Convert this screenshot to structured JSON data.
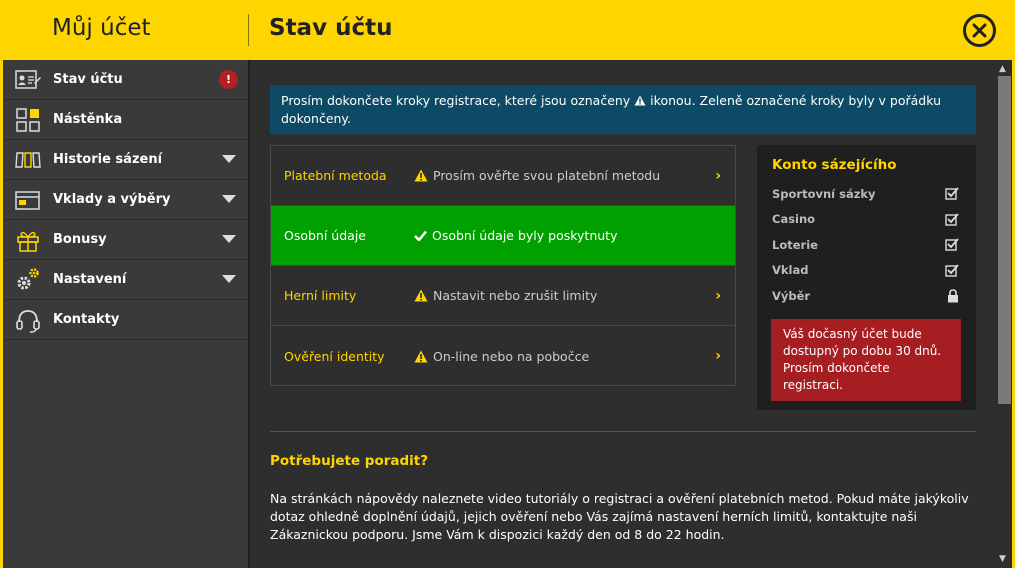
{
  "header": {
    "left_title": "Můj účet",
    "right_title": "Stav účtu"
  },
  "sidebar": {
    "items": [
      {
        "label": "Stav účtu",
        "icon": "id-card-icon",
        "badge": "!"
      },
      {
        "label": "Nástěnka",
        "icon": "dashboard-icon"
      },
      {
        "label": "Historie sázení",
        "icon": "tickets-icon"
      },
      {
        "label": "Vklady a výběry",
        "icon": "wallet-icon"
      },
      {
        "label": "Bonusy",
        "icon": "gift-icon"
      },
      {
        "label": "Nastavení",
        "icon": "gear-icon"
      },
      {
        "label": "Kontakty",
        "icon": "headset-icon"
      }
    ]
  },
  "notice": {
    "text_before": "Prosím dokončete kroky registrace, které jsou označeny",
    "text_after": "ikonou. Zeleně označené kroky byly v pořádku dokončeny."
  },
  "steps": [
    {
      "name": "Platební metoda",
      "status": "Prosím ověřte svou platební metodu",
      "state": "warning"
    },
    {
      "name": "Osobní údaje",
      "status": "Osobní údaje byly poskytnuty",
      "state": "done"
    },
    {
      "name": "Herní limity",
      "status": "Nastavit nebo zrušit limity",
      "state": "warning"
    },
    {
      "name": "Ověření identity",
      "status": "On-line nebo na pobočce",
      "state": "warning"
    }
  ],
  "konto": {
    "title": "Konto sázejícího",
    "rows": [
      {
        "label": "Sportovní sázky",
        "icon": "checkbox-checked-icon"
      },
      {
        "label": "Casino",
        "icon": "checkbox-checked-icon"
      },
      {
        "label": "Loterie",
        "icon": "checkbox-checked-icon"
      },
      {
        "label": "Vklad",
        "icon": "checkbox-checked-icon"
      },
      {
        "label": "Výběr",
        "icon": "lock-icon"
      }
    ],
    "warning": "Váš dočasný účet bude dostupný po dobu 30 dnů. Prosím dokončete registraci."
  },
  "help": {
    "title": "Potřebujete poradit?",
    "text": "Na stránkách nápovědy naleznete video tutoriály o registraci a ověření platebních metod. Pokud máte jakýkoliv dotaz ohledně doplnění údajů, jejich ověření nebo Vás zajímá nastavení herních limitů, kontaktujte naši Zákaznickou podporu. Jsme Vám k dispozici každý den od 8 do 22 hodin."
  },
  "colors": {
    "brand_yellow": "#ffd500",
    "success_green": "#00a000",
    "notice_blue": "#0c4a66",
    "alert_red": "#a71e22"
  }
}
